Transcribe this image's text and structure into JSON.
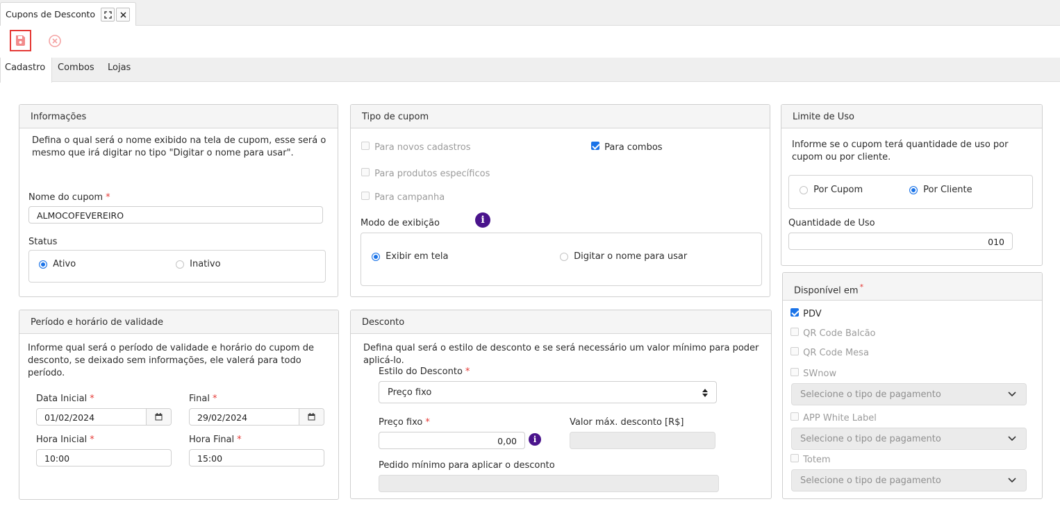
{
  "window": {
    "tab_title": "Cupons de Desconto",
    "maximize_glyph": "⛶",
    "close_glyph": "✕"
  },
  "toolbar": {
    "save_icon": "save-icon",
    "cancel_icon": "cancel-circle-icon"
  },
  "tabs": [
    {
      "label": "Cadastro",
      "active": true
    },
    {
      "label": "Combos",
      "active": false
    },
    {
      "label": "Lojas",
      "active": false
    }
  ],
  "info": {
    "title": "Informações",
    "description": "Defina o qual será o nome exibido na tela de cupom, esse será o mesmo que irá digitar no tipo \"Digitar o nome para usar\".",
    "name_label": "Nome do cupom",
    "name_value": "ALMOCOFEVEREIRO",
    "status_label": "Status",
    "status_active": "Ativo",
    "status_inactive": "Inativo",
    "req": "*"
  },
  "tipo": {
    "title": "Tipo de cupom",
    "opt_novos": "Para novos cadastros",
    "opt_combos": "Para combos",
    "opt_produtos": "Para produtos específicos",
    "opt_campanha": "Para campanha",
    "modo_label": "Modo de exibição",
    "modo_tela": "Exibir em tela",
    "modo_digitar": "Digitar o nome para usar",
    "info_glyph": "i"
  },
  "limite": {
    "title": "Limite de Uso",
    "description": "Informe se o cupom terá quantidade de uso por cupom ou por cliente.",
    "por_cupom": "Por Cupom",
    "por_cliente": "Por Cliente",
    "qtd_label": "Quantidade de Uso",
    "qtd_value": "010"
  },
  "periodo": {
    "title": "Período e horário de validade",
    "description": "Informe qual será o período de validade e horário do cupom de desconto, se deixado sem informações, ele valerá para todo período.",
    "data_inicial_label": "Data Inicial",
    "data_inicial": "01/02/2024",
    "final_label": "Final",
    "final": "29/02/2024",
    "hora_inicial_label": "Hora Inicial",
    "hora_inicial": "10:00",
    "hora_final_label": "Hora Final",
    "hora_final": "15:00"
  },
  "desconto": {
    "title": "Desconto",
    "description": "Defina qual será o estilo de desconto e se será necessário um valor mínimo para poder aplicá-lo.",
    "estilo_label": "Estilo do Desconto",
    "estilo_value": "Preço fixo",
    "preco_label": "Preço fixo",
    "preco_value": "0,00",
    "valor_max_label": "Valor máx. desconto [R$]",
    "pedido_min_label": "Pedido mínimo para aplicar o desconto"
  },
  "disponivel": {
    "title": "Disponível em",
    "pdv": "PDV",
    "qr_balcao": "QR Code Balcão",
    "qr_mesa": "QR Code Mesa",
    "swnow": "SWnow",
    "app_white_label": "APP White Label",
    "totem": "Totem",
    "select_placeholder": "Selecione o tipo de pagamento"
  },
  "colors": {
    "accent": "#1a73e8",
    "required": "#e53935",
    "info": "#4a148c"
  }
}
